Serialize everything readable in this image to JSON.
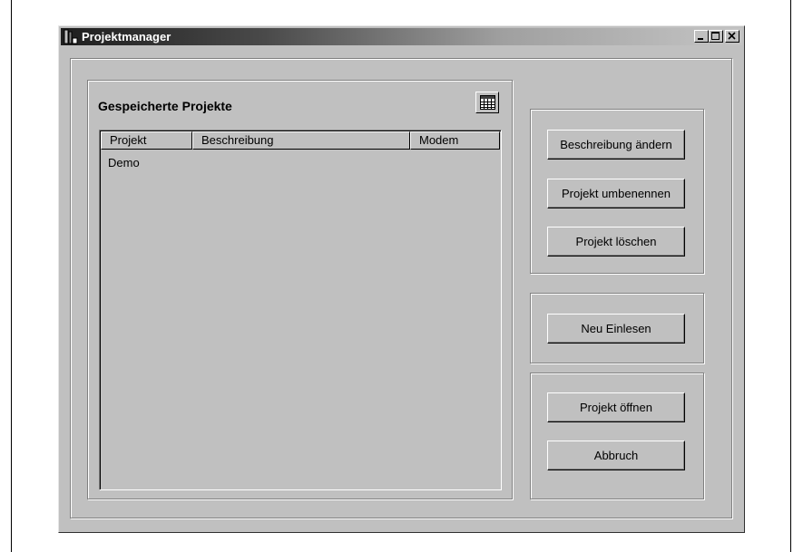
{
  "window": {
    "title": "Projektmanager",
    "controls": {
      "minimize": "_",
      "maximize": "□",
      "close": "X"
    }
  },
  "projects_group": {
    "title": "Gespeicherte Projekte",
    "columns": [
      "Projekt",
      "Beschreibung",
      "Modem"
    ],
    "rows": [
      {
        "projekt": "Demo",
        "beschreibung": "",
        "modem": ""
      }
    ]
  },
  "buttons": {
    "change_description": "Beschreibung ändern",
    "rename_project": "Projekt umbenennen",
    "delete_project": "Projekt löschen",
    "reload": "Neu Einlesen",
    "open_project": "Projekt öffnen",
    "cancel": "Abbruch"
  },
  "icons": {
    "app": "app-icon",
    "calendar": "calendar-icon"
  },
  "colors": {
    "face": "#c0c0c0",
    "title_dark": "#1e1e1e",
    "title_light": "#c4c4c4"
  }
}
